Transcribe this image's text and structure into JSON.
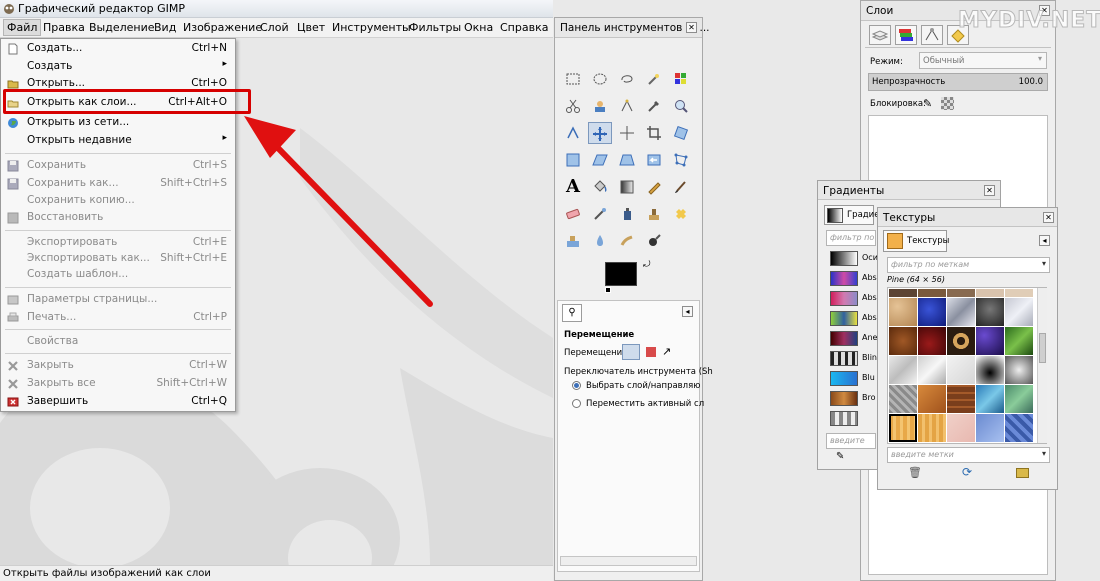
{
  "window": {
    "title": "Графический редактор GIMP"
  },
  "menubar": {
    "items": [
      "Файл",
      "Правка",
      "Выделение",
      "Вид",
      "Изображение",
      "Слой",
      "Цвет",
      "Инструменты",
      "Фильтры",
      "Окна",
      "Справка"
    ],
    "active": "Файл"
  },
  "file_menu": {
    "items": [
      {
        "label": "Создать...",
        "shortcut": "Ctrl+N",
        "icon": "new-file-icon",
        "enabled": true
      },
      {
        "label": "Создать",
        "shortcut": "",
        "icon": "",
        "submenu": true,
        "enabled": true
      },
      {
        "label": "Открыть...",
        "shortcut": "Ctrl+O",
        "icon": "open-folder-icon",
        "enabled": true
      },
      {
        "label": "Открыть как слои...",
        "shortcut": "Ctrl+Alt+O",
        "icon": "open-layers-icon",
        "enabled": true,
        "highlighted": true
      },
      {
        "label": "Открыть из сети...",
        "shortcut": "",
        "icon": "globe-icon",
        "enabled": true
      },
      {
        "label": "Открыть недавние",
        "shortcut": "",
        "icon": "",
        "submenu": true,
        "enabled": true
      },
      {
        "label": "Сохранить",
        "shortcut": "Ctrl+S",
        "icon": "save-icon",
        "enabled": false
      },
      {
        "label": "Сохранить как...",
        "shortcut": "Shift+Ctrl+S",
        "icon": "save-as-icon",
        "enabled": false
      },
      {
        "label": "Сохранить копию...",
        "shortcut": "",
        "icon": "",
        "enabled": false
      },
      {
        "label": "Восстановить",
        "shortcut": "",
        "icon": "revert-icon",
        "enabled": false
      },
      {
        "label": "Экспортировать",
        "shortcut": "Ctrl+E",
        "icon": "",
        "enabled": false
      },
      {
        "label": "Экспортировать как...",
        "shortcut": "Shift+Ctrl+E",
        "icon": "",
        "enabled": false
      },
      {
        "label": "Создать шаблон...",
        "shortcut": "",
        "icon": "",
        "enabled": false
      },
      {
        "label": "Параметры страницы...",
        "shortcut": "",
        "icon": "page-setup-icon",
        "enabled": false
      },
      {
        "label": "Печать...",
        "shortcut": "Ctrl+P",
        "icon": "print-icon",
        "enabled": false
      },
      {
        "label": "Свойства",
        "shortcut": "",
        "icon": "",
        "enabled": false
      },
      {
        "label": "Закрыть",
        "shortcut": "Ctrl+W",
        "icon": "close-icon",
        "enabled": false
      },
      {
        "label": "Закрыть все",
        "shortcut": "Shift+Ctrl+W",
        "icon": "close-all-icon",
        "enabled": false
      },
      {
        "label": "Завершить",
        "shortcut": "Ctrl+Q",
        "icon": "quit-icon",
        "enabled": true
      }
    ]
  },
  "statusbar": {
    "text": "Открыть файлы изображений как слои"
  },
  "toolbox": {
    "title": "Панель инструментов — ...",
    "options": {
      "title": "Перемещение",
      "move_label": "Перемещение:",
      "switch_label": "Переключатель инструмента (Sh",
      "radio1": "Выбрать слой/направляю",
      "radio2": "Переместить активный сл"
    }
  },
  "layers": {
    "title": "Слои",
    "mode_label": "Режим:",
    "mode_value": "Обычный",
    "opacity_label": "Непрозрачность",
    "opacity_value": "100.0",
    "lock_label": "Блокировка:"
  },
  "gradients": {
    "title": "Градиенты",
    "tab": "Градиен",
    "filter_placeholder": "фильтр по",
    "tags_placeholder": "введите",
    "items": [
      "Оси",
      "Abs",
      "Abs",
      "Abs",
      "Ane",
      "Blin",
      "Blu",
      "Bro",
      ""
    ]
  },
  "textures": {
    "title": "Текстуры",
    "tab": "Текстуры",
    "filter_placeholder": "фильтр по меткам",
    "current": "Pine (64 × 56)",
    "tags_placeholder": "введите метки"
  },
  "watermark": "MYDIV.NET",
  "colors": {
    "highlight": "#d60000",
    "arrow": "#e01010"
  }
}
